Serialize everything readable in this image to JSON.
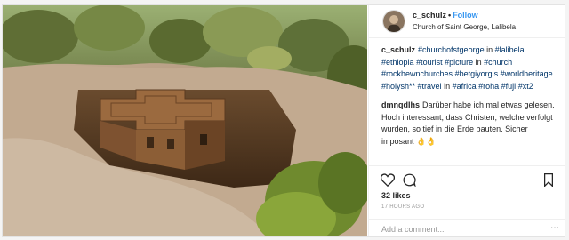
{
  "post": {
    "username": "c_schulz",
    "separator": "•",
    "follow_label": "Follow",
    "location": "Church of Saint George, Lalibela",
    "caption_user": "c_schulz",
    "hashtags": [
      "#churchofstgeorge",
      "#lalibela",
      "#ethiopia",
      "#tourist",
      "#picture",
      "#church",
      "#rockhewnchurches",
      "#betgiyorgis",
      "#worldheritage",
      "#holysh**",
      "#travel",
      "#africa",
      "#roha",
      "#fuji",
      "#xt2"
    ],
    "hashtag_separators": [
      "",
      " in ",
      "",
      " ",
      " ",
      " in ",
      "",
      " ",
      "",
      " ",
      " ",
      " in ",
      "",
      " ",
      " ",
      ""
    ],
    "comment": {
      "username": "dmnqdlhs",
      "text": "Darüber habe ich mal etwas gelesen. Hoch interessant, dass Christen, welche verfolgt wurden, so tief in die Erde bauten. Sicher imposant 👌👌"
    },
    "likes": "32 likes",
    "time": "17 HOURS AGO",
    "comment_placeholder": "Add a comment..."
  },
  "icons": [
    "heart-icon",
    "comment-icon",
    "bookmark-icon",
    "more-options-icon"
  ]
}
